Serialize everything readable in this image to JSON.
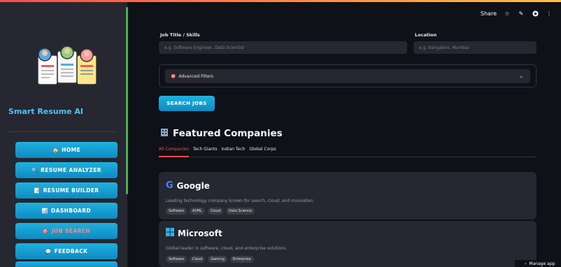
{
  "header": {
    "share_label": "Share",
    "icons": [
      "star-icon",
      "edit-icon",
      "github-icon",
      "more-icon"
    ]
  },
  "sidebar": {
    "brand": "Smart Resume AI",
    "items": [
      {
        "label": "HOME",
        "icon": "home-icon",
        "glyph": "🏠",
        "active": false
      },
      {
        "label": "RESUME ANALYZER",
        "icon": "search-icon",
        "glyph": "🔍",
        "active": false
      },
      {
        "label": "RESUME BUILDER",
        "icon": "document-icon",
        "glyph": "📝",
        "active": false
      },
      {
        "label": "DASHBOARD",
        "icon": "chart-icon",
        "glyph": "📊",
        "active": false
      },
      {
        "label": "JOB SEARCH",
        "icon": "target-icon",
        "glyph": "🎯",
        "active": true
      },
      {
        "label": "FEEDBACK",
        "icon": "chat-icon",
        "glyph": "💬",
        "active": false
      }
    ]
  },
  "search": {
    "job_label": "Job Title / Skills",
    "job_placeholder": "e.g. Software Engineer, Data Scientist",
    "location_label": "Location",
    "location_placeholder": "e.g. Bangalore, Mumbai",
    "advanced_filters": "Advanced Filters",
    "button": "SEARCH JOBS"
  },
  "featured": {
    "title": "Featured Companies",
    "tabs": [
      "All Companies",
      "Tech Giants",
      "Indian Tech",
      "Global Corps"
    ],
    "companies": [
      {
        "name": "Google",
        "description": "Leading technology company known for search, cloud, and innovation",
        "tags": [
          "Software",
          "AI/ML",
          "Cloud",
          "Data Science"
        ]
      },
      {
        "name": "Microsoft",
        "description": "Global leader in software, cloud, and enterprise solutions",
        "tags": [
          "Software",
          "Cloud",
          "Gaming",
          "Enterprise"
        ]
      }
    ]
  },
  "footer": {
    "manage": "Manage app"
  },
  "colors": {
    "accent": "#ff4b4b",
    "button": "#1fa8dc",
    "brand": "#4fc3f7",
    "sidebar_scroll": "#4caf50"
  }
}
